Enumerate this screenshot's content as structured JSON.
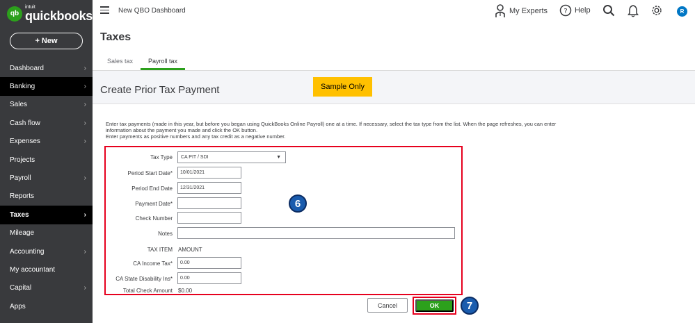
{
  "brand": {
    "intuit": "intuit",
    "name": "quickbooks",
    "mark": "qb",
    "accent": "#2ca01c",
    "sidebar_bg": "#393a3d"
  },
  "sidebar": {
    "new_label": "+ New",
    "items": [
      {
        "label": "Dashboard"
      },
      {
        "label": "Banking"
      },
      {
        "label": "Sales"
      },
      {
        "label": "Cash flow"
      },
      {
        "label": "Expenses"
      },
      {
        "label": "Projects"
      },
      {
        "label": "Payroll"
      },
      {
        "label": "Reports"
      },
      {
        "label": "Taxes"
      },
      {
        "label": "Mileage"
      },
      {
        "label": "Accounting"
      },
      {
        "label": "My accountant"
      },
      {
        "label": "Capital"
      },
      {
        "label": "Apps"
      }
    ]
  },
  "topbar": {
    "title": "New QBO Dashboard",
    "experts": "My Experts",
    "help": "Help",
    "avatar": "R"
  },
  "page": {
    "title": "Taxes",
    "tabs": [
      {
        "label": "Sales tax"
      },
      {
        "label": "Payroll tax"
      }
    ],
    "section_title": "Create Prior Tax Payment",
    "sample_badge": "Sample Only",
    "instructions": [
      "Enter tax payments (made in this year, but before you began using QuickBooks Online Payroll) one at a time. If necessary, select the tax type from the list. When the page refreshes, you can enter",
      "information about the payment you made and click the OK button.",
      "Enter payments as positive numbers and any tax credit as a negative number."
    ]
  },
  "form": {
    "tax_type_label": "Tax Type",
    "tax_type_value": "CA PIT / SDI",
    "period_start_label": "Period Start Date*",
    "period_start_value": "10/01/2021",
    "period_end_label": "Period End Date",
    "period_end_value": "12/31/2021",
    "payment_date_label": "Payment Date*",
    "payment_date_value": "",
    "check_number_label": "Check Number",
    "check_number_value": "",
    "notes_label": "Notes",
    "notes_value": "",
    "tax_item_header": "TAX ITEM",
    "amount_header": "AMOUNT",
    "income_tax_label": "CA Income Tax*",
    "income_tax_value": "0.00",
    "sdi_label": "CA State Disability Ins*",
    "sdi_value": "0.00",
    "total_label": "Total Check Amount",
    "total_value": "$0.00"
  },
  "actions": {
    "cancel": "Cancel",
    "ok": "OK"
  },
  "callouts": {
    "form_step": "6",
    "ok_step": "7"
  }
}
